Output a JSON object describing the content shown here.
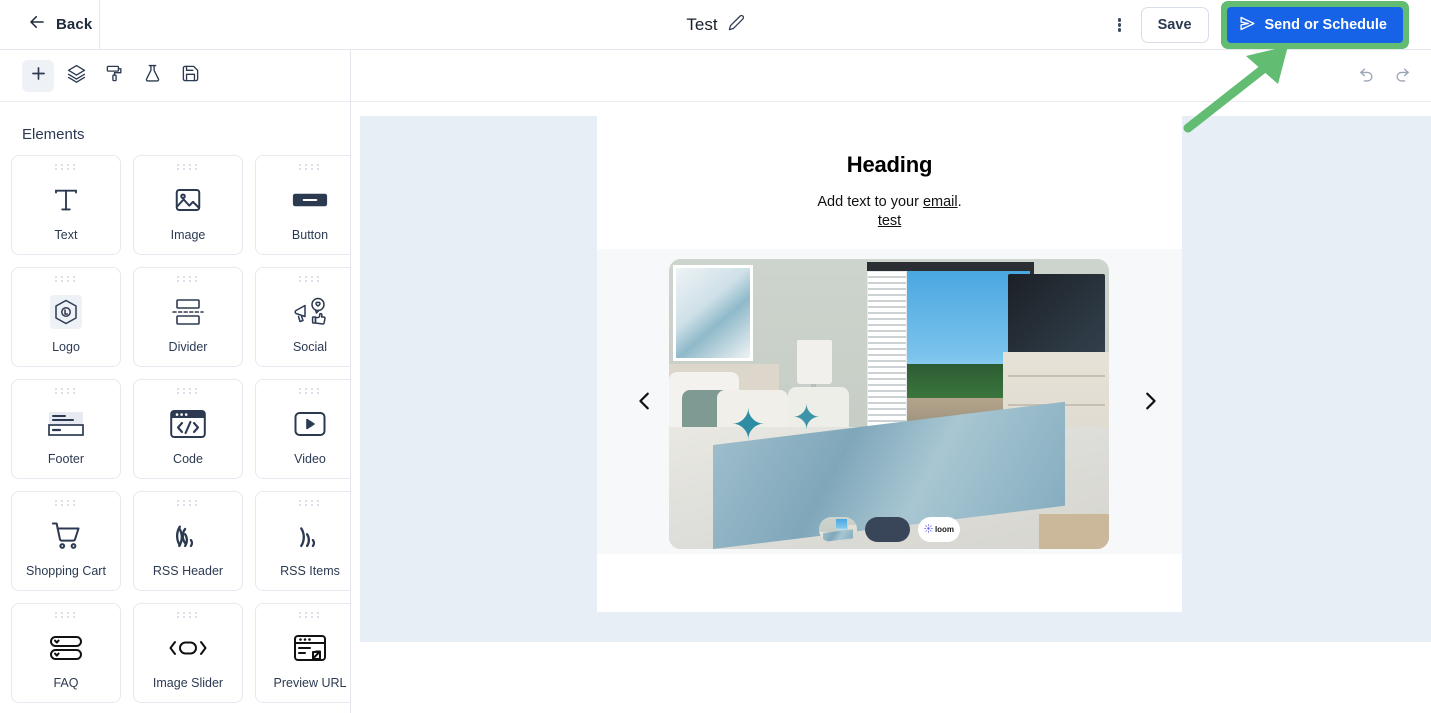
{
  "topbar": {
    "back_label": "Back",
    "doc_title": "Test",
    "edit_icon": "pencil-icon",
    "kebab_icon": "more-vertical-icon",
    "save_label": "Save",
    "send_label": "Send or Schedule",
    "send_icon": "send-icon",
    "highlight_color": "#62bc72",
    "send_button_color": "#1763e8"
  },
  "toolbar": {
    "items": [
      {
        "name": "add-element-tool",
        "icon": "plus-icon",
        "active": true
      },
      {
        "name": "layers-tool",
        "icon": "layers-icon",
        "active": false
      },
      {
        "name": "styles-tool",
        "icon": "paint-roller-icon",
        "active": false
      },
      {
        "name": "test-tool",
        "icon": "flask-icon",
        "active": false
      },
      {
        "name": "save-template-tool",
        "icon": "floppy-disk-icon",
        "active": false
      }
    ]
  },
  "elements_panel": {
    "title": "Elements",
    "items": [
      {
        "label": "Text",
        "icon": "text-icon"
      },
      {
        "label": "Image",
        "icon": "image-icon"
      },
      {
        "label": "Button",
        "icon": "button-icon"
      },
      {
        "label": "Logo",
        "icon": "logo-icon"
      },
      {
        "label": "Divider",
        "icon": "divider-icon"
      },
      {
        "label": "Social",
        "icon": "social-icon"
      },
      {
        "label": "Footer",
        "icon": "footer-icon"
      },
      {
        "label": "Code",
        "icon": "code-icon"
      },
      {
        "label": "Video",
        "icon": "video-icon"
      },
      {
        "label": "Shopping Cart",
        "icon": "shopping-cart-icon"
      },
      {
        "label": "RSS Header",
        "icon": "rss-icon"
      },
      {
        "label": "RSS Items",
        "icon": "rss-icon"
      },
      {
        "label": "FAQ",
        "icon": "faq-icon"
      },
      {
        "label": "Image Slider",
        "icon": "image-slider-icon"
      },
      {
        "label": "Preview URL",
        "icon": "preview-url-icon"
      }
    ]
  },
  "canvas": {
    "undo_icon": "undo-icon",
    "redo_icon": "redo-icon",
    "background_color": "#e8eef6",
    "email": {
      "heading": "Heading",
      "body_prefix": "Add text to your ",
      "body_link": "email",
      "body_suffix": ".",
      "second_line": "test",
      "slider": {
        "prev_icon": "chevron-left-icon",
        "next_icon": "chevron-right-icon",
        "thumbnails": [
          {
            "name": "thumbnail-bedroom-photo",
            "type": "photo"
          },
          {
            "name": "thumbnail-dark",
            "type": "solid"
          },
          {
            "name": "thumbnail-loom",
            "type": "logo",
            "label": "loom"
          }
        ],
        "current_image_alt": "Coastal bedroom with balcony view"
      }
    }
  },
  "annotation": {
    "arrow_color": "#62bc72",
    "points_to": "send-or-schedule-button"
  }
}
